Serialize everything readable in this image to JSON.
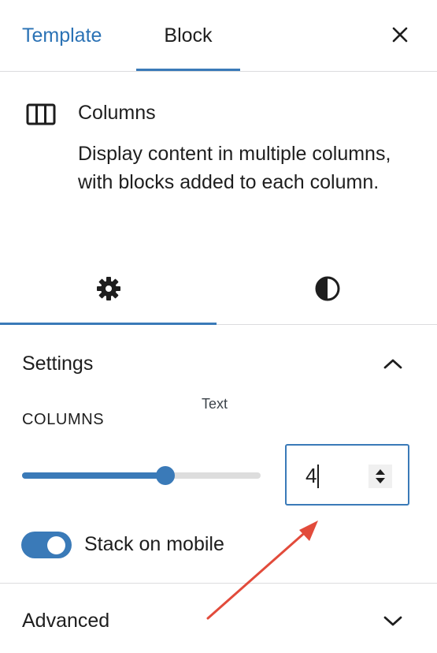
{
  "tabs": {
    "template_label": "Template",
    "block_label": "Block",
    "active": "Block"
  },
  "block": {
    "icon": "columns-icon",
    "title": "Columns",
    "description": "Display content in multiple columns, with blocks added to each column."
  },
  "inspector_tabs": [
    {
      "icon": "gear-icon",
      "active": true
    },
    {
      "icon": "contrast-icon",
      "active": false
    }
  ],
  "settings": {
    "title": "Settings",
    "expanded": true,
    "tooltip": "Text",
    "columns_label": "COLUMNS",
    "columns_value": "4",
    "slider_fraction": 0.6,
    "stack_on_mobile_label": "Stack on mobile",
    "stack_on_mobile": true
  },
  "advanced": {
    "title": "Advanced",
    "expanded": false
  },
  "colors": {
    "accent": "#3a7ab8",
    "link": "#2a72b5",
    "annotation_arrow": "#e24b3b"
  }
}
